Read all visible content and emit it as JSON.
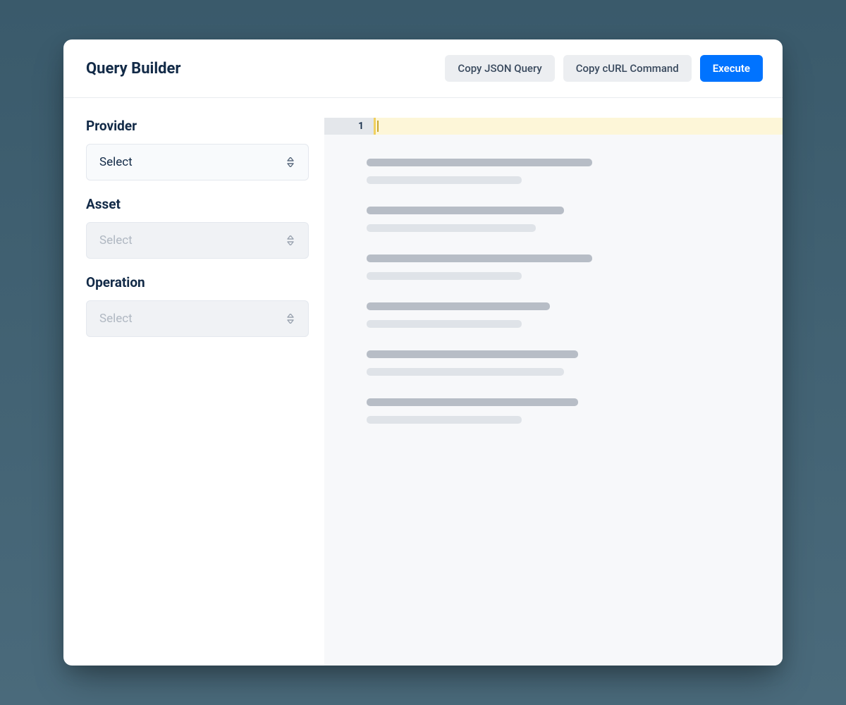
{
  "header": {
    "title": "Query Builder",
    "copy_json_label": "Copy JSON Query",
    "copy_curl_label": "Copy cURL Command",
    "execute_label": "Execute"
  },
  "fields": {
    "provider": {
      "label": "Provider",
      "value": "Select",
      "enabled": true
    },
    "asset": {
      "label": "Asset",
      "value": "Select",
      "enabled": false
    },
    "operation": {
      "label": "Operation",
      "value": "Select",
      "enabled": false
    }
  },
  "editor": {
    "line_number": "1"
  }
}
